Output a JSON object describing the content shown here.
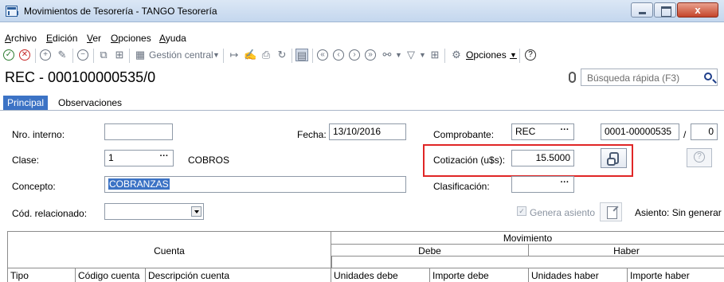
{
  "window": {
    "title": "Movimientos de Tesorería - TANGO Tesorería",
    "close_glyph": "x"
  },
  "menu": [
    "Archivo",
    "Edición",
    "Ver",
    "Opciones",
    "Ayuda"
  ],
  "toolbar": {
    "gestion_central": "Gestión central",
    "opciones": "Opciones"
  },
  "record": {
    "title": "REC -  000100000535/0",
    "search_placeholder": "Búsqueda rápida (F3)"
  },
  "tabs": [
    "Principal",
    "Observaciones"
  ],
  "form": {
    "nro_interno_label": "Nro. interno:",
    "nro_interno_value": "",
    "fecha_label": "Fecha:",
    "fecha_value": "13/10/2016",
    "comprobante_label": "Comprobante:",
    "comprobante_value": "REC",
    "comprobante_numero": "0001-00000535",
    "separator": "/",
    "comprobante_sufijo": "0",
    "clase_label": "Clase:",
    "clase_value": "1",
    "clase_desc": "COBROS",
    "cotizacion_label": "Cotización (u$s):",
    "cotizacion_value": "15.5000",
    "concepto_label": "Concepto:",
    "concepto_value": "COBRANZAS",
    "clasificacion_label": "Clasificación:",
    "clasificacion_value": "",
    "cod_relacionado_label": "Cód. relacionado:",
    "cod_relacionado_value": "",
    "genera_asiento_label": "Genera asiento",
    "asiento_label": "Asiento: Sin generar",
    "dots": "···"
  },
  "grid": {
    "cuenta": "Cuenta",
    "movimiento": "Movimiento",
    "debe": "Debe",
    "haber": "Haber",
    "columns": [
      "Tipo",
      "Código cuenta",
      "Descripción cuenta",
      "Unidades debe",
      "Importe debe",
      "Unidades haber",
      "Importe haber"
    ]
  },
  "colors": {
    "accent": "#3c73c5",
    "highlight_border": "#e02626"
  }
}
